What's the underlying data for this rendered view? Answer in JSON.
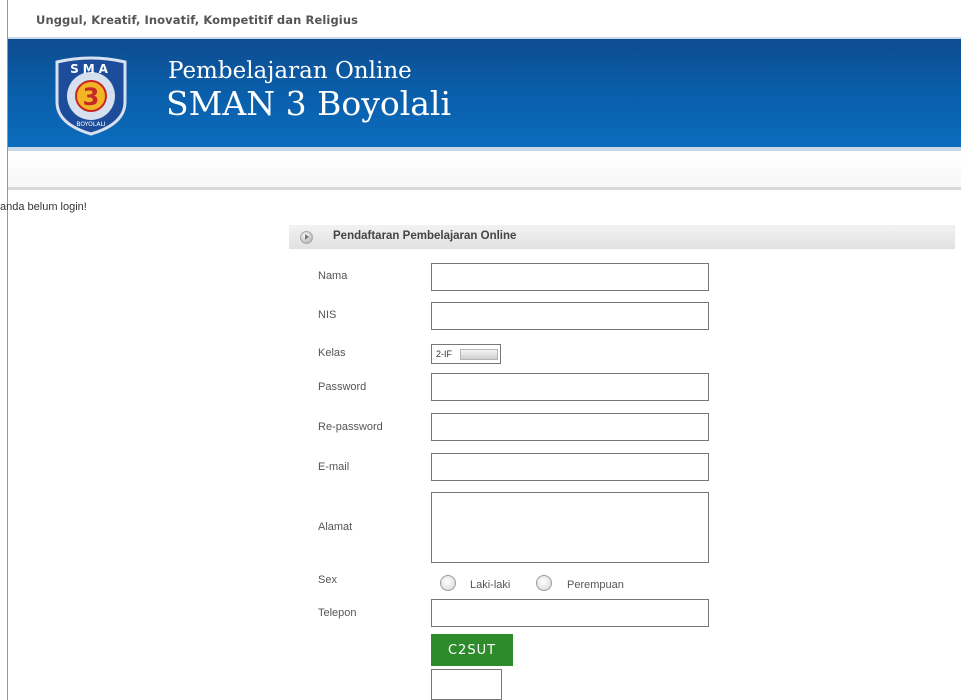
{
  "site": {
    "tagline": "Unggul, Kreatif, Inovatif, Kompetitif dan Religius",
    "subtitle": "Pembelajaran Online",
    "title": "SMAN 3 Boyolali",
    "logo": {
      "top_text": "SMA",
      "number": "3",
      "bottom_text": "BOYOLALI",
      "colors": {
        "shield": "#1d4c9a",
        "ring": "#d7e0ee",
        "center": "#f3b524",
        "number": "#c62828"
      }
    },
    "colors": {
      "header_dark": "#0e4c8f",
      "header_light": "#0b6cbd"
    }
  },
  "status": {
    "login_message": "anda belum login!"
  },
  "form": {
    "title": "Pendaftaran Pembelajaran Online",
    "fields": {
      "nama": {
        "label": "Nama",
        "value": ""
      },
      "nis": {
        "label": "NIS",
        "value": ""
      },
      "kelas": {
        "label": "Kelas",
        "value": "2-IF"
      },
      "password": {
        "label": "Password",
        "value": ""
      },
      "repassword": {
        "label": "Re-password",
        "value": ""
      },
      "email": {
        "label": "E-mail",
        "value": ""
      },
      "alamat": {
        "label": "Alamat",
        "value": ""
      },
      "sex": {
        "label": "Sex",
        "options": [
          "Laki-laki",
          "Perempuan"
        ],
        "selected": null
      },
      "telepon": {
        "label": "Telepon",
        "value": ""
      }
    },
    "captcha": {
      "code": "C2SUT",
      "color": "#2e8b2c",
      "input_value": ""
    }
  }
}
